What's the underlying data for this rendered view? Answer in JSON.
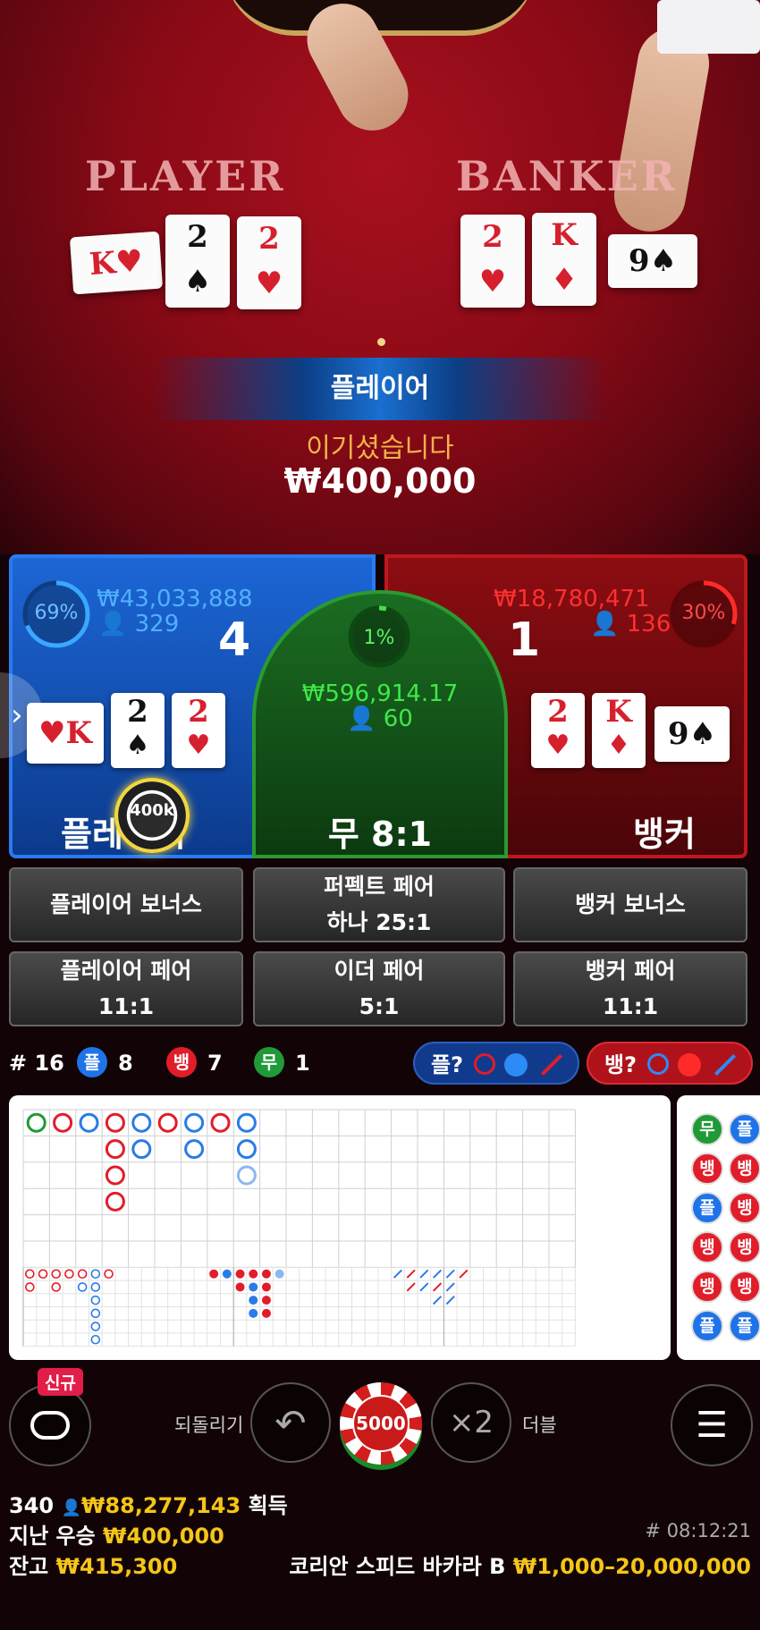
{
  "table": {
    "player_label": "PLAYER",
    "banker_label": "BANKER",
    "player_cards": [
      {
        "rank": "K",
        "suit": "♥",
        "color": "red"
      },
      {
        "rank": "2",
        "suit": "♠",
        "color": "blk"
      },
      {
        "rank": "2",
        "suit": "♥",
        "color": "red"
      }
    ],
    "banker_cards": [
      {
        "rank": "2",
        "suit": "♥",
        "color": "red"
      },
      {
        "rank": "K",
        "suit": "♦",
        "color": "red"
      },
      {
        "rank": "9",
        "suit": "♠",
        "color": "blk"
      }
    ]
  },
  "result": {
    "winner_label": "플레이어",
    "win_text": "이기셨습니다",
    "win_amount": "₩400,000"
  },
  "player_panel": {
    "percent": "69%",
    "percent_value": 0.69,
    "total": "₩43,033,888",
    "players": "329",
    "score": "4",
    "label": "플레이어",
    "chip": "400k",
    "cards": [
      {
        "rank": "K",
        "suit": "♥",
        "color": "red"
      },
      {
        "rank": "2",
        "suit": "♠",
        "color": "blk"
      },
      {
        "rank": "2",
        "suit": "♥",
        "color": "red"
      }
    ]
  },
  "tie_panel": {
    "percent": "1%",
    "percent_value": 0.01,
    "total": "₩596,914.17",
    "players": "60",
    "label": "무 8:1"
  },
  "banker_panel": {
    "percent": "30%",
    "percent_value": 0.3,
    "total": "₩18,780,471",
    "players": "136",
    "score": "1",
    "label": "뱅커",
    "cards": [
      {
        "rank": "2",
        "suit": "♥",
        "color": "red"
      },
      {
        "rank": "K",
        "suit": "♦",
        "color": "red"
      },
      {
        "rank": "9",
        "suit": "♠",
        "color": "blk"
      }
    ]
  },
  "side_bets": [
    {
      "line1": "플레이어 보너스",
      "line2": ""
    },
    {
      "line1": "퍼펙트 페어",
      "line2": "하나 25:1"
    },
    {
      "line1": "뱅커 보너스",
      "line2": ""
    },
    {
      "line1": "플레이어 페어",
      "line2": "11:1"
    },
    {
      "line1": "이더 페어",
      "line2": "5:1"
    },
    {
      "line1": "뱅커 페어",
      "line2": "11:1"
    }
  ],
  "stats": {
    "round": "# 16",
    "player_glyph": "플",
    "player_count": "8",
    "banker_glyph": "뱅",
    "banker_count": "7",
    "tie_glyph": "무",
    "tie_count": "1",
    "ask_player": "플?",
    "ask_banker": "뱅?"
  },
  "bead_road": [
    "무",
    "뱅",
    "플",
    "뱅",
    "뱅",
    "플",
    "플",
    "뱅",
    "뱅",
    "뱅",
    "뱅",
    "플"
  ],
  "controls": {
    "new_badge": "신규",
    "undo_label": "되돌리기",
    "chip_value": "5000",
    "double_symbol": "×2",
    "double_label": "더블"
  },
  "footer": {
    "players_count": "340",
    "total_won": "₩88,277,143",
    "won_label": "획득",
    "last_win_label": "지난 우승",
    "last_win": "₩400,000",
    "balance_label": "잔고",
    "balance": "₩415,300",
    "game_id": "# 08:12:21",
    "table_name": "코리안 스피드 바카라 B",
    "limits": "₩1,000–20,000,000"
  },
  "colors": {
    "player": "#1c66d6",
    "banker": "#c0161e",
    "tie": "#2b9a30",
    "accent": "#f5c518"
  }
}
